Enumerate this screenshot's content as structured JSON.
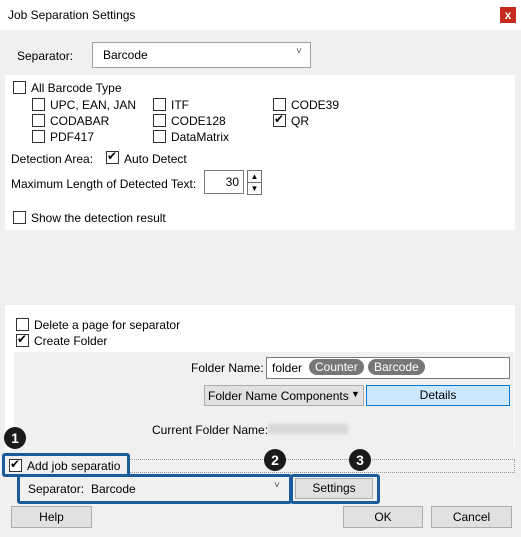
{
  "window": {
    "title": "Job Separation Settings",
    "close": "x"
  },
  "top": {
    "separator_label": "Separator:",
    "separator_value": "Barcode",
    "all_barcode": {
      "label": "All Barcode Type",
      "checked": false
    },
    "types": [
      {
        "label": "UPC, EAN, JAN",
        "checked": false
      },
      {
        "label": "ITF",
        "checked": false
      },
      {
        "label": "CODE39",
        "checked": false
      },
      {
        "label": "CODABAR",
        "checked": false
      },
      {
        "label": "CODE128",
        "checked": false
      },
      {
        "label": "QR",
        "checked": true
      },
      {
        "label": "PDF417",
        "checked": false
      },
      {
        "label": "DataMatrix",
        "checked": false
      }
    ],
    "detection_area_label": "Detection Area:",
    "auto_detect": {
      "label": "Auto Detect",
      "checked": true
    },
    "max_length_label": "Maximum Length of Detected Text:",
    "max_length_value": "30",
    "show_result": {
      "label": "Show the detection result",
      "checked": false
    }
  },
  "folder": {
    "delete_page": {
      "label": "Delete a page for separator",
      "checked": false
    },
    "create_folder": {
      "label": "Create Folder",
      "checked": true
    },
    "folder_name_label": "Folder Name:",
    "folder_name_text": "folder",
    "folder_name_tokens": [
      "Counter",
      "Barcode"
    ],
    "components_button": "Folder Name Components",
    "details_button": "Details",
    "current_folder_label": "Current Folder Name:"
  },
  "bottom": {
    "add_job": {
      "label": "Add job separatio",
      "checked": true
    },
    "separator_label": "Separator:",
    "separator_value": "Barcode",
    "settings_button": "Settings",
    "help_button": "Help",
    "ok_button": "OK",
    "cancel_button": "Cancel"
  },
  "callouts": [
    "1",
    "2",
    "3"
  ],
  "colors": {
    "accent_blue": "#1a5b99",
    "details_bg": "#cce8ff",
    "close_red": "#c42b1c"
  }
}
